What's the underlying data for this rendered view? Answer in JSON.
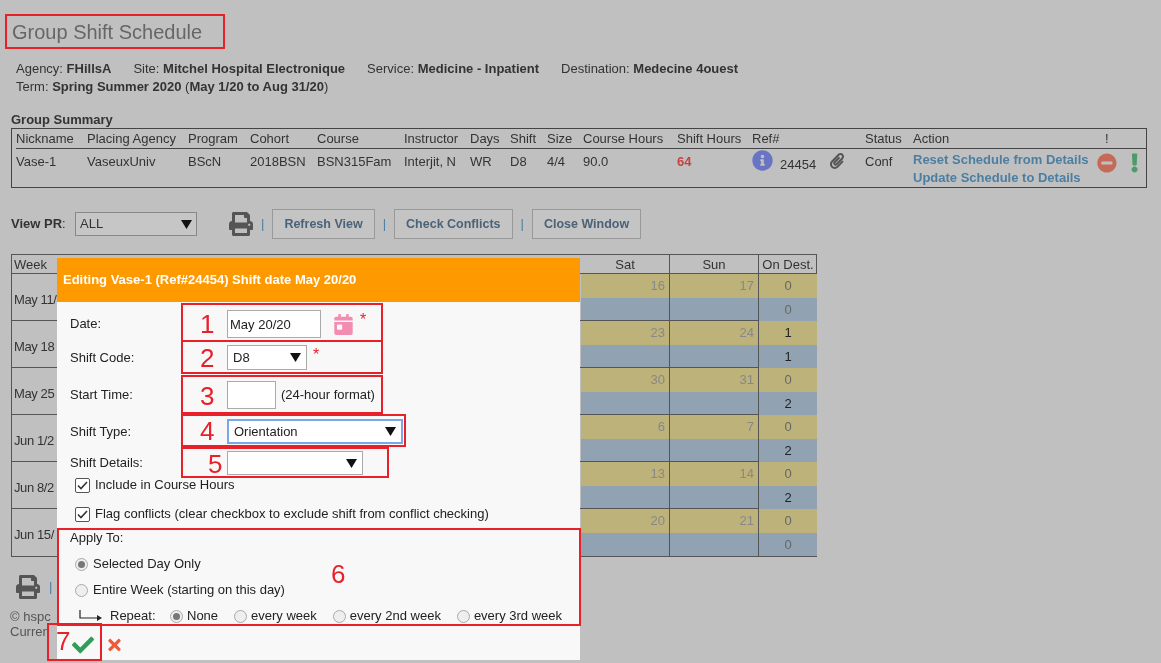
{
  "title": {
    "text": "Group Shift Schedule",
    "highlighted": true
  },
  "info": [
    {
      "label": "Agency:",
      "value": "FHillsA"
    },
    {
      "label": "Site:",
      "value": "Mitchel Hospital Electronique"
    },
    {
      "label": "Service:",
      "value": "Medicine - Inpatient"
    },
    {
      "label": "Destination:",
      "value": "Medecine 4ouest"
    }
  ],
  "term": {
    "label": "Term:",
    "value": "**Spring Summer 2020** (**May 1/20 to Aug 31/20**)"
  },
  "group_summary": {
    "heading": "Group Summary",
    "columns": [
      "Nickname",
      "Placing Agency",
      "Program",
      "Cohort",
      "Course",
      "Instructor",
      "Days",
      "Shift",
      "Size",
      "Course Hours",
      "Shift Hours",
      "Ref#",
      "Status",
      "Action",
      "!"
    ],
    "row": {
      "nickname": "Vase-1",
      "placing_agency": "VaseuxUniv",
      "program": "BScN",
      "cohort": "2018BSN",
      "course": "BSN315Fam",
      "instructor": "Interjit, N",
      "days": "WR",
      "shift": "D8",
      "size": "4/4",
      "course_hours": "90.0",
      "shift_hours": "64",
      "shift_hours_flagged": true,
      "ref": "24454",
      "status": "Conf",
      "actions": [
        "Reset Schedule from Details",
        "Update Schedule to Details"
      ]
    }
  },
  "toolbar": {
    "view_pr_label": "**View PR**:",
    "view_pr_value": "ALL",
    "items": [
      {
        "kind": "print"
      },
      {
        "kind": "separator",
        "text": "|"
      },
      {
        "kind": "button",
        "label": "Refresh View"
      },
      {
        "kind": "separator",
        "text": "|"
      },
      {
        "kind": "button",
        "label": "Check Conflicts"
      },
      {
        "kind": "separator",
        "text": "|"
      },
      {
        "kind": "button",
        "label": "Close Window"
      }
    ]
  },
  "calendar": {
    "columns": [
      "Week",
      "Sat",
      "Sun",
      "On Dest."
    ],
    "weeks": [
      {
        "label": "May 11/",
        "sat": "16",
        "sun": "17",
        "on_dest": [
          {
            "value": "0",
            "muted": true
          },
          {
            "value": "0",
            "muted": true
          }
        ]
      },
      {
        "label": "May 18",
        "sat": "23",
        "sun": "24",
        "on_dest": [
          {
            "value": "1",
            "muted": false
          },
          {
            "value": "1",
            "muted": false
          }
        ]
      },
      {
        "label": "May 25",
        "sat": "30",
        "sun": "31",
        "on_dest": [
          {
            "value": "0",
            "muted": true
          },
          {
            "value": "2",
            "muted": false
          }
        ]
      },
      {
        "label": "Jun 1/2",
        "sat": "6",
        "sun": "7",
        "on_dest": [
          {
            "value": "0",
            "muted": true
          },
          {
            "value": "2",
            "muted": false
          }
        ]
      },
      {
        "label": "Jun 8/2",
        "sat": "13",
        "sun": "14",
        "on_dest": [
          {
            "value": "0",
            "muted": true
          },
          {
            "value": "2",
            "muted": false
          }
        ]
      },
      {
        "label": "Jun 15/",
        "sat": "20",
        "sun": "21",
        "on_dest": [
          {
            "value": "0",
            "muted": true
          },
          {
            "value": "0",
            "muted": true
          }
        ]
      }
    ]
  },
  "footer": {
    "separator": "|",
    "lines": [
      "© hspc",
      "Curren"
    ]
  },
  "dialog": {
    "title": "Editing Vase-1 (Ref#24454) Shift date May 20/20",
    "fields": [
      {
        "kind": "date",
        "label": "Date:",
        "value": "May 20/20",
        "required_mark": "*"
      },
      {
        "kind": "select",
        "label": "Shift Code:",
        "value": "D8",
        "required_mark": "*"
      },
      {
        "kind": "time",
        "label": "Start Time:",
        "hint": "(24-hour format)"
      },
      {
        "kind": "select",
        "label": "Shift Type:",
        "value": "Orientation",
        "focused": true
      },
      {
        "kind": "select",
        "label": "Shift Details:"
      }
    ],
    "checkboxes": [
      {
        "label": "Include in Course Hours",
        "checked": true
      },
      {
        "label": "Flag conflicts (clear checkbox to exclude shift from conflict checking)",
        "checked": true
      }
    ],
    "apply_to": {
      "label": "Apply To:",
      "options": [
        {
          "label": "Selected Day Only",
          "selected": true
        },
        {
          "label": "Entire Week (starting on this day)",
          "selected": false
        }
      ],
      "repeat": {
        "label": "Repeat:",
        "options": [
          {
            "label": "None",
            "selected": true
          },
          {
            "label": "every week",
            "selected": false
          },
          {
            "label": "every 2nd week",
            "selected": false
          },
          {
            "label": "every 3rd week",
            "selected": false
          }
        ]
      }
    }
  },
  "annotations": [
    {
      "number": "1"
    },
    {
      "number": "2"
    },
    {
      "number": "3"
    },
    {
      "number": "4"
    },
    {
      "number": "5"
    },
    {
      "number": "6"
    },
    {
      "number": "7"
    }
  ]
}
